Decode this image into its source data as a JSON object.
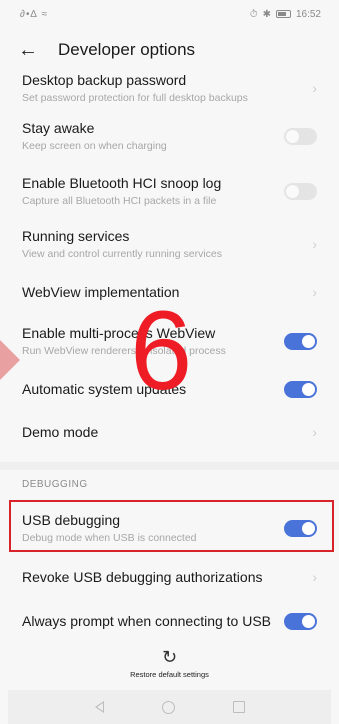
{
  "status": {
    "signal": "ᴸᴴ⁙ᴸ⁙ ≈",
    "icons": "⏰ ✱",
    "time": "16:52"
  },
  "app_bar": {
    "title": "Developer options"
  },
  "rows": [
    {
      "title": "Desktop backup password",
      "sub": "Set password protection for full desktop backups",
      "control": "chevron"
    },
    {
      "title": "Stay awake",
      "sub": "Keep screen on when charging",
      "control": "toggle-off"
    },
    {
      "title": "Enable Bluetooth HCI snoop log",
      "sub": "Capture all Bluetooth HCI packets in a file",
      "control": "toggle-off"
    },
    {
      "title": "Running services",
      "sub": "View and control currently running services",
      "control": "chevron"
    },
    {
      "title": "WebView implementation",
      "sub": "",
      "control": "chevron"
    },
    {
      "title": "Enable multi-process WebView",
      "sub": "Run WebView renderers in isolated process",
      "control": "toggle-on"
    },
    {
      "title": "Automatic system updates",
      "sub": "",
      "control": "toggle-on"
    },
    {
      "title": "Demo mode",
      "sub": "",
      "control": "chevron"
    }
  ],
  "section": {
    "header": "DEBUGGING"
  },
  "debug_rows": [
    {
      "title": "USB debugging",
      "sub": "Debug mode when USB is connected",
      "control": "toggle-on"
    },
    {
      "title": "Revoke USB debugging authorizations",
      "sub": "",
      "control": "chevron"
    },
    {
      "title": "Always prompt when connecting to USB",
      "sub": "",
      "control": "toggle-on"
    }
  ],
  "overlay": {
    "step_number": "6"
  },
  "footer": {
    "restore_label": "Restore default settings"
  },
  "colors": {
    "toggle_on": "#4a73d9",
    "highlight": "#d9232a",
    "step_number": "#ee1c24"
  }
}
